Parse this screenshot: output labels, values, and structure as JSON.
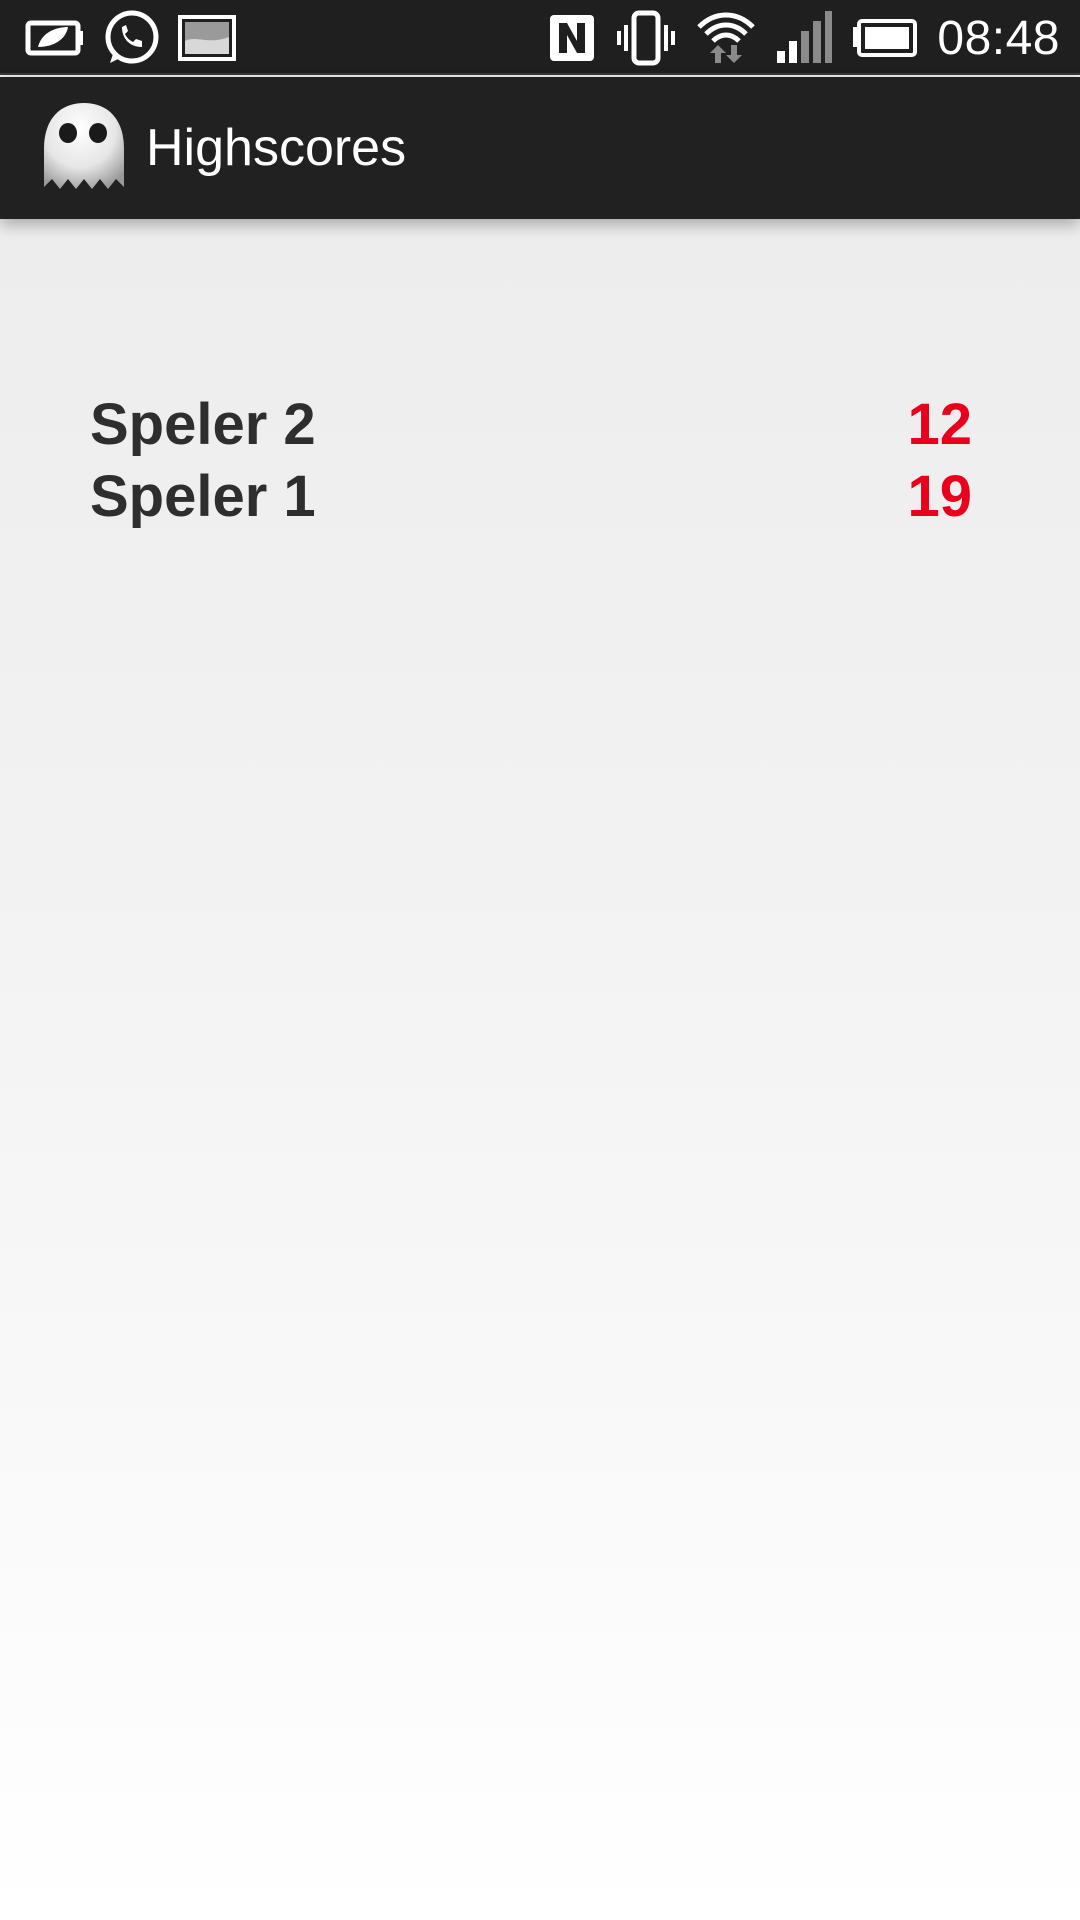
{
  "status_bar": {
    "time": "08:48",
    "left_icons": [
      "power-saver-icon",
      "whatsapp-icon",
      "gallery-notification-icon"
    ],
    "right_icons": [
      "nfc-icon",
      "vibrate-icon",
      "wifi-icon",
      "signal-icon",
      "battery-icon"
    ]
  },
  "action_bar": {
    "title": "Highscores",
    "icon": "ghost-app-icon"
  },
  "scores": [
    {
      "name": "Speler 2",
      "score": "12"
    },
    {
      "name": "Speler 1",
      "score": "19"
    }
  ],
  "colors": {
    "score": "#e8001c",
    "name": "#2e2e2e",
    "bar": "#212121"
  }
}
